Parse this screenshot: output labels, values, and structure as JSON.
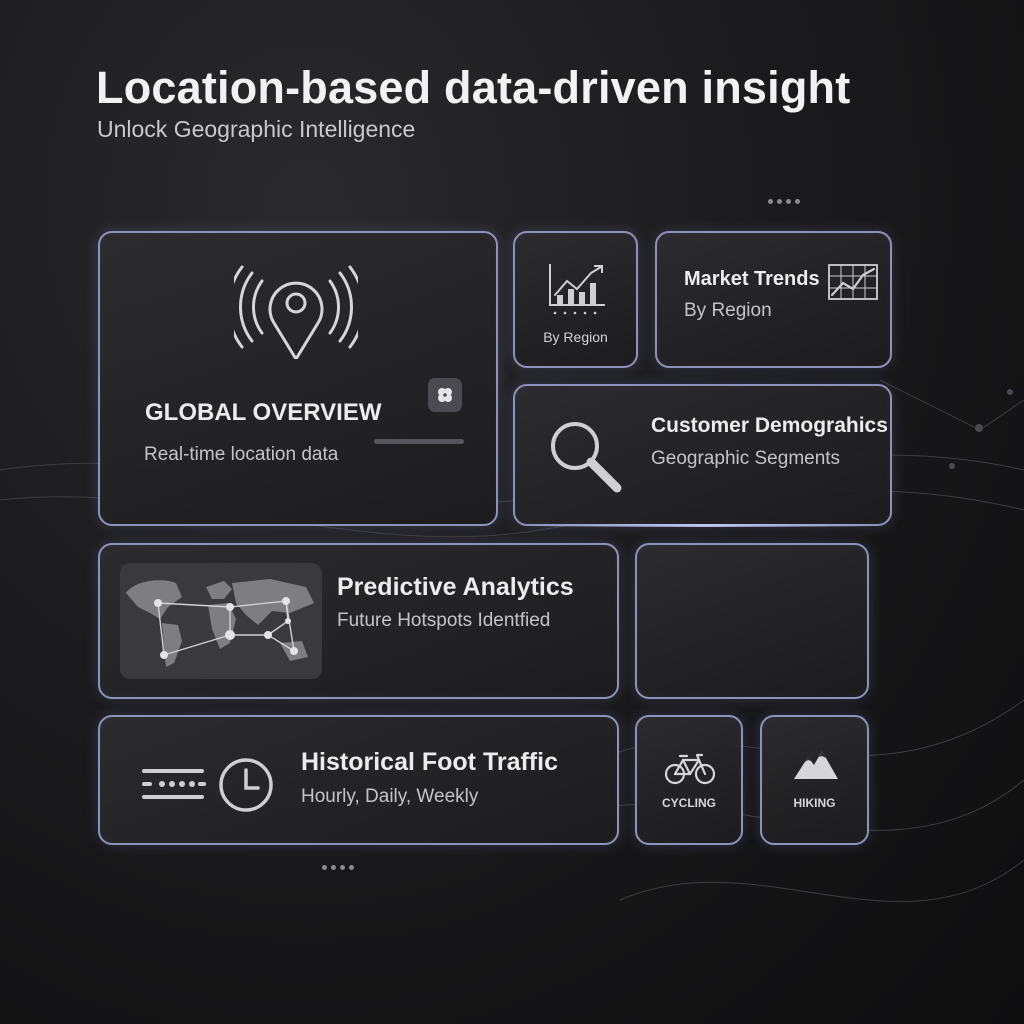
{
  "header": {
    "title": "Location-based data-driven insight",
    "subtitle": "Unlock Geographic Intelligence"
  },
  "cards": {
    "global_overview": {
      "title": "GLOBAL OVERVIEW",
      "subtitle": "Real-time location data",
      "icon": "location-pin-broadcast-icon",
      "widget_icon": "clover-icon"
    },
    "region_chart": {
      "label": "By Region",
      "icon": "growth-chart-icon"
    },
    "market_trends": {
      "title": "Market Trends",
      "subtitle": "By Region",
      "icon": "map-chart-icon"
    },
    "customer_demographics": {
      "title": "Customer Demograhics",
      "subtitle": "Geographic Segments",
      "icon": "magnifier-icon"
    },
    "predictive_analytics": {
      "title": "Predictive Analytics",
      "subtitle": "Future Hotspots Identfied",
      "icon": "world-network-map-icon"
    },
    "historical_foot_traffic": {
      "title": "Historical Foot Traffic",
      "subtitle": "Hourly, Daily, Weekly",
      "icon": "timeline-clock-icon"
    },
    "cycling": {
      "label": "CYCLING",
      "icon": "bicycle-icon"
    },
    "hiking": {
      "label": "HIKING",
      "icon": "mountains-icon"
    }
  },
  "colors": {
    "card_border": "#8e92bb",
    "background": "#1b1b1d",
    "accent_glow": "#c8cdff"
  }
}
